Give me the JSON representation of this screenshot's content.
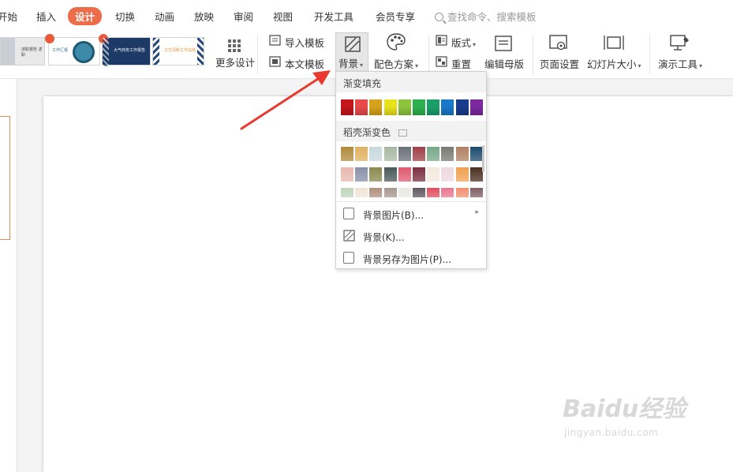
{
  "menu": {
    "tabs": [
      "开始",
      "插入",
      "设计",
      "切换",
      "动画",
      "放映",
      "审阅",
      "视图",
      "开发工具",
      "会员专享"
    ],
    "active_tab": "设计",
    "search_placeholder": "查找命令、搜索模板"
  },
  "ribbon": {
    "more_design": "更多设计",
    "import_template": "导入模板",
    "text_template": "本文模板",
    "background": "背景",
    "color_scheme": "配色方案",
    "layout": "版式",
    "reset": "重置",
    "edit_master": "编辑母版",
    "page_setup": "页面设置",
    "slide_size": "幻灯片大小",
    "presenter_tools": "演示工具",
    "template_thumbs": [
      {
        "colors": [
          "#e9e9e9",
          "#5a6a7a"
        ],
        "badge": false,
        "text": "述职报告 述职"
      },
      {
        "colors": [
          "#ffffff",
          "#2b6f8a"
        ],
        "badge": true,
        "text": "工作汇报"
      },
      {
        "colors": [
          "#1d3a66",
          "#ffffff"
        ],
        "badge": true,
        "text": "大气商务工作报告"
      },
      {
        "colors": [
          "#ffffff",
          "#e8923a"
        ],
        "badge": false,
        "text": "文艺清新工作总结"
      }
    ]
  },
  "background_menu": {
    "gradient_fill_label": "渐变填充",
    "gradient_colors": [
      "#c4141c",
      "#e84a4a",
      "#d6a21c",
      "#e8e21c",
      "#8cc43c",
      "#2eb04e",
      "#1a9e6a",
      "#1a78c8",
      "#1a3c8c",
      "#7a2a9e"
    ],
    "docer_gradient_label": "稻壳渐变色",
    "docer_rows": [
      [
        "#b08a3c",
        "#e0b060",
        "#c8d8dc",
        "#a8b8a0",
        "#6a7078",
        "#a04048",
        "#78a888",
        "#7a7a72",
        "#b08060",
        "#1c4a6c"
      ],
      [
        "#e8b8b0",
        "#8890a8",
        "#8a8a50",
        "#485a58",
        "#e05a70",
        "#7a3040",
        "#f4e8dc",
        "#f0d8e0",
        "#f0a050",
        "#4a3020"
      ],
      [
        "#c0d4bc",
        "#f0e4d4",
        "#b09080",
        "#a89890",
        "#e8e8e4",
        "#605860",
        "#e05060",
        "#e87890",
        "#f09070",
        "#806068"
      ]
    ],
    "items": [
      {
        "label": "背景图片(B)...",
        "has_submenu": true,
        "icon": "image-file-icon"
      },
      {
        "label": "背景(K)...",
        "has_submenu": false,
        "icon": "background-pattern-icon"
      },
      {
        "label": "背景另存为图片(P)...",
        "has_submenu": false,
        "icon": "save-image-icon"
      }
    ]
  },
  "watermark": {
    "logo": "Baidu经验",
    "url": "jingyan.baidu.com"
  },
  "colors": {
    "accent": "#ed6c4a",
    "arrow": "#e83a2e"
  }
}
